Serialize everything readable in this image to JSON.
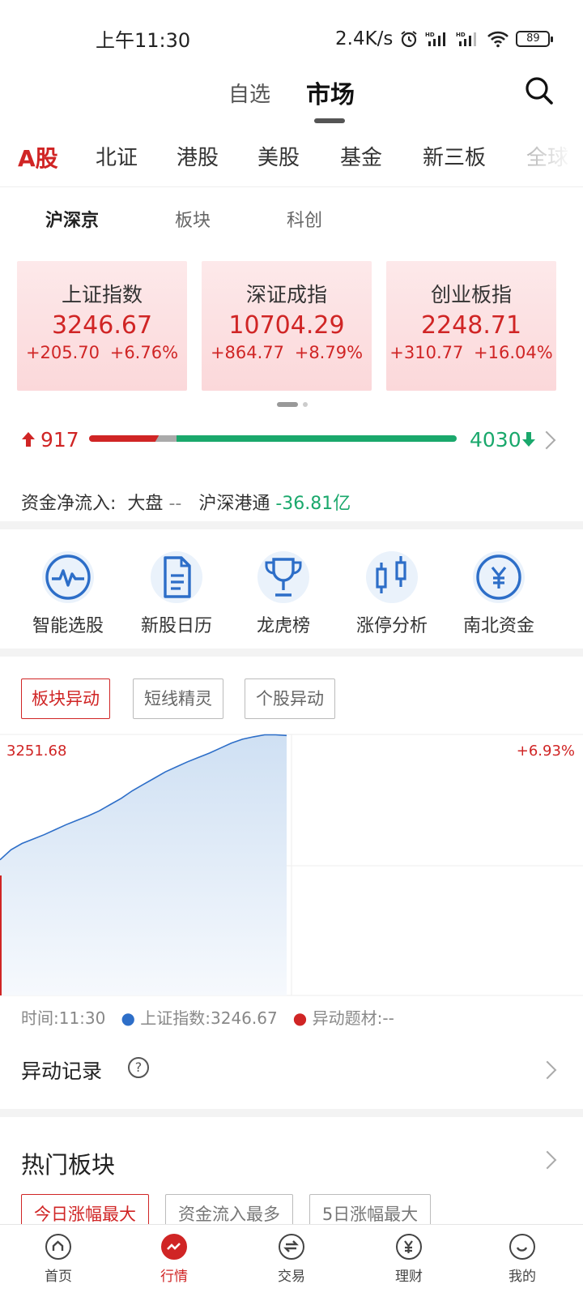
{
  "status_bar": {
    "time": "上午11:30",
    "speed": "2.4K/s",
    "battery": "89"
  },
  "top_nav": {
    "watchlist": "自选",
    "market": "市场"
  },
  "market_tabs": [
    "A股",
    "北证",
    "港股",
    "美股",
    "基金",
    "新三板",
    "全球"
  ],
  "sub_tabs": [
    "沪深京",
    "板块",
    "科创"
  ],
  "indices": [
    {
      "name": "上证指数",
      "value": "3246.67",
      "change": "+205.70",
      "pct": "+6.76%"
    },
    {
      "name": "深证成指",
      "value": "10704.29",
      "change": "+864.77",
      "pct": "+8.79%"
    },
    {
      "name": "创业板指",
      "value": "2248.71",
      "change": "+310.77",
      "pct": "+16.04%"
    }
  ],
  "breadth": {
    "up": "917",
    "down": "4030"
  },
  "fund_flow": {
    "label": "资金净流入:",
    "dapan_label": "大盘",
    "dapan_value": "--",
    "hsgt_label": "沪深港通",
    "hsgt_value": "-36.81亿"
  },
  "quick_entries": [
    {
      "label": "智能选股",
      "icon": "pulse-icon"
    },
    {
      "label": "新股日历",
      "icon": "document-icon"
    },
    {
      "label": "龙虎榜",
      "icon": "trophy-icon"
    },
    {
      "label": "涨停分析",
      "icon": "candlestick-icon"
    },
    {
      "label": "南北资金",
      "icon": "yuan-icon"
    }
  ],
  "anomaly_tabs": [
    "板块异动",
    "短线精灵",
    "个股异动"
  ],
  "chart_data": {
    "type": "line",
    "title": "",
    "y_top_label": "3251.68",
    "y_top_pct": "+6.93%",
    "series": [
      {
        "values": [
          3052,
          3068,
          3078,
          3085,
          3092,
          3100,
          3108,
          3115,
          3122,
          3130,
          3140,
          3150,
          3162,
          3172,
          3182,
          3192,
          3200,
          3208,
          3215,
          3222,
          3230,
          3238,
          3244,
          3248,
          3251,
          3251,
          3250
        ]
      }
    ],
    "legend_time": "时间:11:30",
    "legend_index": "上证指数:3246.67",
    "legend_theme": "异动题材:--"
  },
  "anomaly_record": {
    "title": "异动记录",
    "help": "?"
  },
  "hot_sectors": {
    "title": "热门板块",
    "tabs": [
      "今日涨幅最大",
      "资金流入最多",
      "5日涨幅最大"
    ]
  },
  "bottom_nav": [
    "首页",
    "行情",
    "交易",
    "理财",
    "我的"
  ],
  "colors": {
    "up": "#d02525",
    "down": "#1aa86c",
    "accent": "#2d6ec8"
  }
}
